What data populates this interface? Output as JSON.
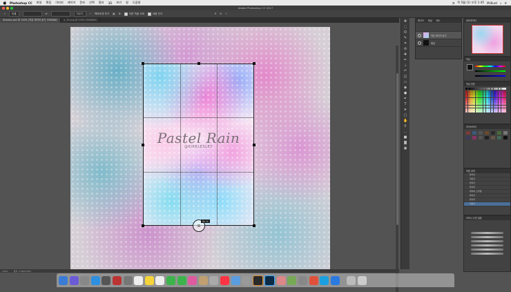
{
  "menubar": {
    "app_name": "Photoshop CC",
    "items": [
      "파일",
      "편집",
      "이미지",
      "레이어",
      "문자",
      "선택",
      "필터",
      "3D",
      "보기",
      "창",
      "도움말"
    ],
    "clock": "목 5월 (1) 오후 1:45",
    "user": "MrBuet"
  },
  "window": {
    "title": "Adobe Photoshop CC 2017"
  },
  "options": {
    "ratio_label": "비율",
    "clear_label": "지우기",
    "straighten_label": "똑바르게 하기",
    "delete_cropped_label": "자른 픽셀 삭제",
    "content_aware_label": "내용 인식"
  },
  "tabs": [
    {
      "label": "Shaaloo.psd @ 100% (작은 레이어 송기, RGB/8#)"
    },
    {
      "label": "a_15.png @ 100% (RGB/8#)"
    }
  ],
  "canvas": {
    "title": "Pastel Rain",
    "subtitle": "@KIRELESLEY"
  },
  "tooltip": {
    "text": "W: H:"
  },
  "status": {
    "zoom": "100%",
    "doc": "문서: 2.5M/5.83M"
  },
  "layers_panel": {
    "tabs": [
      "레이어",
      "채널",
      "패스"
    ],
    "layers": [
      {
        "name": "작은 레이어 송기",
        "selected": true
      },
      {
        "name": "배경",
        "selected": false
      }
    ]
  },
  "navigator_panel": {
    "title": "네비게이터"
  },
  "color_panel": {
    "title": "색상"
  },
  "swatches_panel": {
    "title": "색상 견본"
  },
  "library_panel": {
    "title": "라이브러리"
  },
  "history_panel": {
    "title": "작업 내역",
    "items": [
      "붙이기",
      "자르기",
      "붙이기",
      "붙이기",
      "레이어 스타일",
      "붙이기",
      "붙이기",
      "자르기"
    ]
  },
  "brush_panel": {
    "title": "브러시 사전 설정"
  },
  "colors": {
    "app_bg": "#535353",
    "panel_bg": "#424242",
    "accent": "#4b6f9a"
  }
}
